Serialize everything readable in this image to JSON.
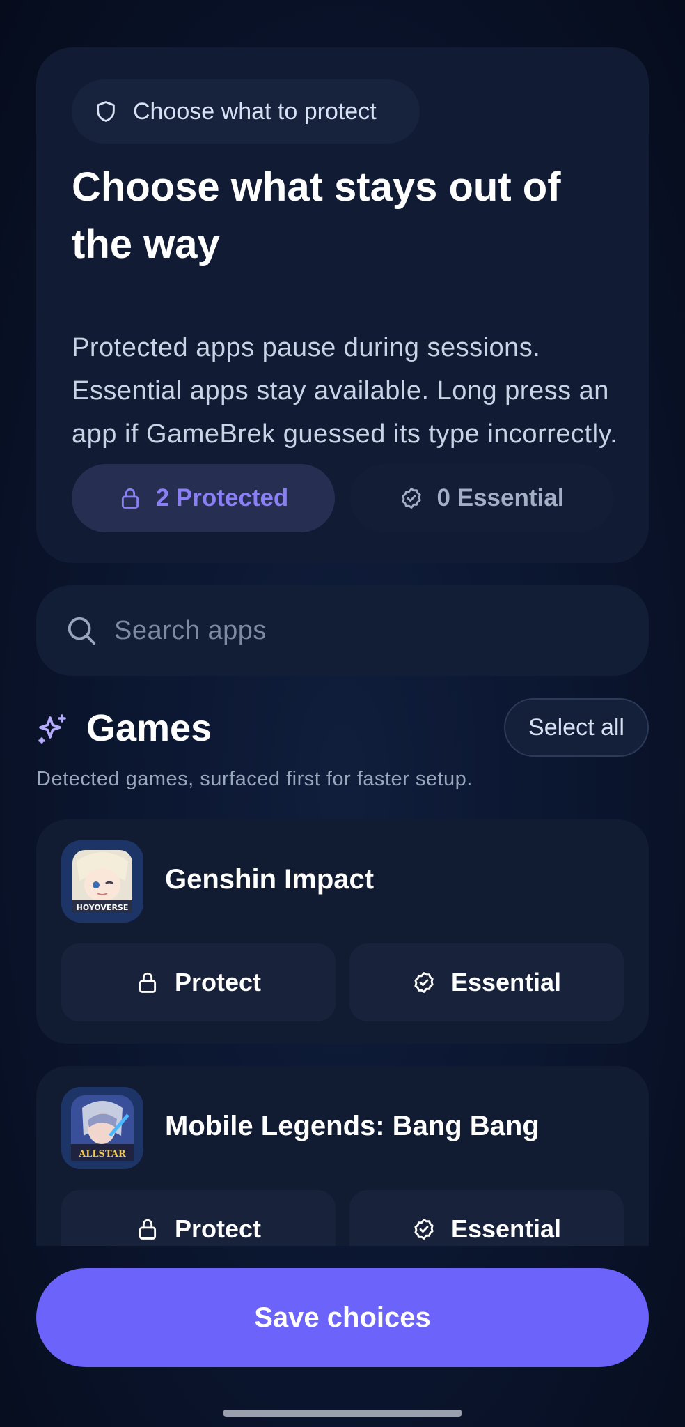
{
  "hero": {
    "tag_label": "Choose what to protect",
    "title": "Choose what stays out of the way",
    "description": "Protected apps pause during sessions. Essential apps stay available. Long press an app if GameBrek guessed its type incorrectly.",
    "protected_count": "2 Protected",
    "essential_count": "0 Essential"
  },
  "search": {
    "placeholder": "Search apps"
  },
  "section": {
    "title": "Games",
    "select_all_label": "Select all",
    "subtitle": "Detected games, surfaced first for faster setup."
  },
  "apps": [
    {
      "name": "Genshin Impact",
      "icon": "genshin-impact-app-icon",
      "protect_label": "Protect",
      "essential_label": "Essential"
    },
    {
      "name": "Mobile Legends: Bang Bang",
      "icon": "mobile-legends-app-icon",
      "protect_label": "Protect",
      "essential_label": "Essential"
    }
  ],
  "footer": {
    "save_label": "Save choices"
  },
  "colors": {
    "accent": "#6c63fa",
    "background": "#0b1630",
    "card": "#111b33",
    "protected_text": "#8b7ff5"
  }
}
